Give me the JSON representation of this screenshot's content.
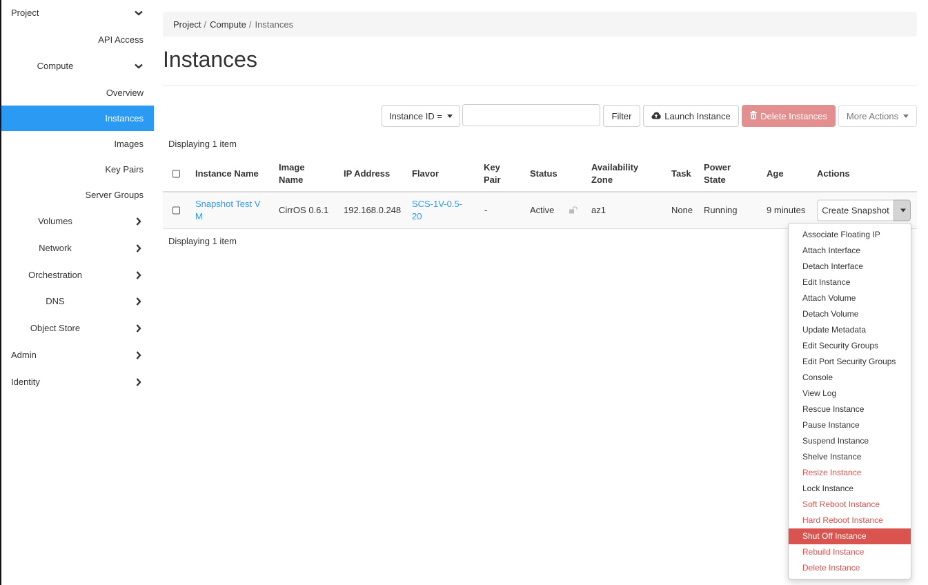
{
  "sidebar": {
    "items": [
      {
        "label": "Project",
        "level": 0,
        "chevron": "down"
      },
      {
        "label": "API Access",
        "level": 2
      },
      {
        "label": "Compute",
        "level": 1,
        "chevron": "down"
      },
      {
        "label": "Overview",
        "level": 2
      },
      {
        "label": "Instances",
        "level": 2,
        "active": true
      },
      {
        "label": "Images",
        "level": 2
      },
      {
        "label": "Key Pairs",
        "level": 2
      },
      {
        "label": "Server Groups",
        "level": 2
      },
      {
        "label": "Volumes",
        "level": 1,
        "chevron": "right"
      },
      {
        "label": "Network",
        "level": 1,
        "chevron": "right"
      },
      {
        "label": "Orchestration",
        "level": 1,
        "chevron": "right"
      },
      {
        "label": "DNS",
        "level": 1,
        "chevron": "right"
      },
      {
        "label": "Object Store",
        "level": 1,
        "chevron": "right"
      },
      {
        "label": "Admin",
        "level": 0,
        "chevron": "right"
      },
      {
        "label": "Identity",
        "level": 0,
        "chevron": "right"
      }
    ],
    "active_color": "#2b9af3"
  },
  "breadcrumb": {
    "items": [
      "Project",
      "Compute",
      "Instances"
    ],
    "separator": "/"
  },
  "page": {
    "title": "Instances"
  },
  "toolbar": {
    "filter_field_label": "Instance ID =",
    "filter_input_value": "",
    "filter_button": "Filter",
    "launch_button": "Launch Instance",
    "delete_button": "Delete Instances",
    "more_actions_button": "More Actions"
  },
  "table": {
    "display_count_top": "Displaying 1 item",
    "display_count_bottom": "Displaying 1 item",
    "headers": {
      "instance_name": "Instance Name",
      "image_name": [
        "Image",
        "Name"
      ],
      "ip_address": "IP Address",
      "flavor": "Flavor",
      "key_pair": [
        "Key",
        "Pair"
      ],
      "status": "Status",
      "availability_zone": [
        "Availability",
        "Zone"
      ],
      "task": "Task",
      "power_state": [
        "Power",
        "State"
      ],
      "age": "Age",
      "actions": "Actions"
    },
    "rows": [
      {
        "instance_name": [
          "Snapshot Test V",
          "M"
        ],
        "image_name": "CirrOS 0.6.1",
        "ip_address": "192.168.0.248",
        "flavor": [
          "SCS-1V-0.5-",
          "20"
        ],
        "key_pair": "-",
        "status": "Active",
        "lock_icon": "unlocked-icon",
        "availability_zone": "az1",
        "task": "None",
        "power_state": "Running",
        "age": "9 minutes",
        "primary_action": "Create Snapshot"
      }
    ]
  },
  "actions_menu": {
    "items": [
      {
        "label": "Associate Floating IP",
        "style": "normal"
      },
      {
        "label": "Attach Interface",
        "style": "normal"
      },
      {
        "label": "Detach Interface",
        "style": "normal"
      },
      {
        "label": "Edit Instance",
        "style": "normal"
      },
      {
        "label": "Attach Volume",
        "style": "normal"
      },
      {
        "label": "Detach Volume",
        "style": "normal"
      },
      {
        "label": "Update Metadata",
        "style": "normal"
      },
      {
        "label": "Edit Security Groups",
        "style": "normal"
      },
      {
        "label": "Edit Port Security Groups",
        "style": "normal"
      },
      {
        "label": "Console",
        "style": "normal"
      },
      {
        "label": "View Log",
        "style": "normal"
      },
      {
        "label": "Rescue Instance",
        "style": "normal"
      },
      {
        "label": "Pause Instance",
        "style": "normal"
      },
      {
        "label": "Suspend Instance",
        "style": "normal"
      },
      {
        "label": "Shelve Instance",
        "style": "normal"
      },
      {
        "label": "Resize Instance",
        "style": "danger"
      },
      {
        "label": "Lock Instance",
        "style": "normal"
      },
      {
        "label": "Soft Reboot Instance",
        "style": "danger"
      },
      {
        "label": "Hard Reboot Instance",
        "style": "danger"
      },
      {
        "label": "Shut Off Instance",
        "style": "highlight"
      },
      {
        "label": "Rebuild Instance",
        "style": "danger"
      },
      {
        "label": "Delete Instance",
        "style": "danger"
      }
    ],
    "danger_color": "#d9534f"
  }
}
